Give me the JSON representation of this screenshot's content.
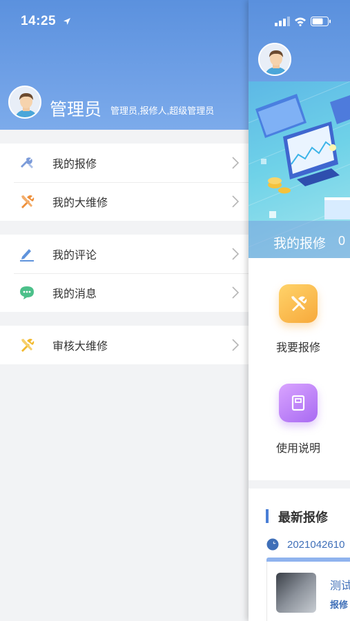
{
  "status_bar": {
    "time": "14:25"
  },
  "drawer": {
    "user_name": "管理员",
    "user_roles": "管理员,报修人,超级管理员",
    "groups": [
      {
        "items": [
          {
            "label": "我的报修",
            "icon": "wrench-hammer-icon",
            "color": "#7b9bd9"
          },
          {
            "label": "我的大维修",
            "icon": "tools-icon",
            "color": "#ee8f3a"
          }
        ]
      },
      {
        "items": [
          {
            "label": "我的评论",
            "icon": "pen-icon",
            "color": "#5f93dc"
          },
          {
            "label": "我的消息",
            "icon": "chat-bubble-icon",
            "color": "#4cc08a"
          }
        ]
      },
      {
        "items": [
          {
            "label": "审核大维修",
            "icon": "tools-icon",
            "color": "#f2b92d"
          }
        ]
      }
    ]
  },
  "main": {
    "banner_label": "我的报修",
    "banner_count": "0",
    "tiles": [
      {
        "label": "我要报修",
        "icon": "repair-tools-icon"
      },
      {
        "label": "使用说明",
        "icon": "book-icon"
      }
    ],
    "latest": {
      "title": "最新报修",
      "record_no": "2021042610",
      "record_title": "测试",
      "record_sub": "报修"
    }
  },
  "colors": {
    "header_blue": "#5b91de",
    "link_blue": "#3f6fb8"
  }
}
